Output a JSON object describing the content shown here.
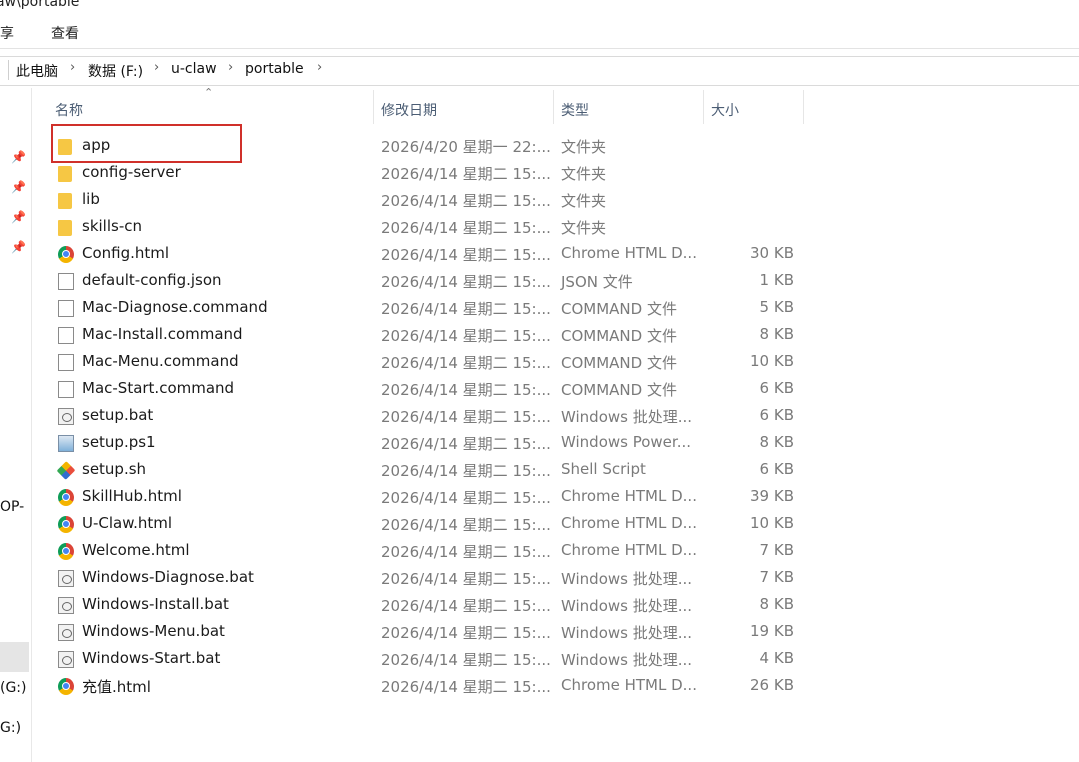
{
  "window": {
    "title_path": "aw\\portable"
  },
  "menu": {
    "share": "享",
    "view": "查看"
  },
  "breadcrumb": [
    "此电脑",
    "数据 (F:)",
    "u-claw",
    "portable"
  ],
  "sidebar": {
    "truncated_labels": [
      "OP-",
      "(G:)",
      "G:)"
    ]
  },
  "columns": {
    "name": "名称",
    "date": "修改日期",
    "type": "类型",
    "size": "大小"
  },
  "files": [
    {
      "name": "app",
      "date": "2026/4/20 星期一 22:...",
      "type": "文件夹",
      "size": "",
      "icon": "folder-icon"
    },
    {
      "name": "config-server",
      "date": "2026/4/14 星期二 15:...",
      "type": "文件夹",
      "size": "",
      "icon": "folder-icon"
    },
    {
      "name": "lib",
      "date": "2026/4/14 星期二 15:...",
      "type": "文件夹",
      "size": "",
      "icon": "folder-icon"
    },
    {
      "name": "skills-cn",
      "date": "2026/4/14 星期二 15:...",
      "type": "文件夹",
      "size": "",
      "icon": "folder-icon"
    },
    {
      "name": "Config.html",
      "date": "2026/4/14 星期二 15:...",
      "type": "Chrome HTML D...",
      "size": "30 KB",
      "icon": "chrome-html-icon"
    },
    {
      "name": "default-config.json",
      "date": "2026/4/14 星期二 15:...",
      "type": "JSON 文件",
      "size": "1 KB",
      "icon": "document-icon"
    },
    {
      "name": "Mac-Diagnose.command",
      "date": "2026/4/14 星期二 15:...",
      "type": "COMMAND 文件",
      "size": "5 KB",
      "icon": "document-icon"
    },
    {
      "name": "Mac-Install.command",
      "date": "2026/4/14 星期二 15:...",
      "type": "COMMAND 文件",
      "size": "8 KB",
      "icon": "document-icon"
    },
    {
      "name": "Mac-Menu.command",
      "date": "2026/4/14 星期二 15:...",
      "type": "COMMAND 文件",
      "size": "10 KB",
      "icon": "document-icon"
    },
    {
      "name": "Mac-Start.command",
      "date": "2026/4/14 星期二 15:...",
      "type": "COMMAND 文件",
      "size": "6 KB",
      "icon": "document-icon"
    },
    {
      "name": "setup.bat",
      "date": "2026/4/14 星期二 15:...",
      "type": "Windows 批处理...",
      "size": "6 KB",
      "icon": "batch-file-icon"
    },
    {
      "name": "setup.ps1",
      "date": "2026/4/14 星期二 15:...",
      "type": "Windows Power...",
      "size": "8 KB",
      "icon": "powershell-icon"
    },
    {
      "name": "setup.sh",
      "date": "2026/4/14 星期二 15:...",
      "type": "Shell Script",
      "size": "6 KB",
      "icon": "git-shell-icon"
    },
    {
      "name": "SkillHub.html",
      "date": "2026/4/14 星期二 15:...",
      "type": "Chrome HTML D...",
      "size": "39 KB",
      "icon": "chrome-html-icon"
    },
    {
      "name": "U-Claw.html",
      "date": "2026/4/14 星期二 15:...",
      "type": "Chrome HTML D...",
      "size": "10 KB",
      "icon": "chrome-html-icon"
    },
    {
      "name": "Welcome.html",
      "date": "2026/4/14 星期二 15:...",
      "type": "Chrome HTML D...",
      "size": "7 KB",
      "icon": "chrome-html-icon"
    },
    {
      "name": "Windows-Diagnose.bat",
      "date": "2026/4/14 星期二 15:...",
      "type": "Windows 批处理...",
      "size": "7 KB",
      "icon": "batch-file-icon"
    },
    {
      "name": "Windows-Install.bat",
      "date": "2026/4/14 星期二 15:...",
      "type": "Windows 批处理...",
      "size": "8 KB",
      "icon": "batch-file-icon"
    },
    {
      "name": "Windows-Menu.bat",
      "date": "2026/4/14 星期二 15:...",
      "type": "Windows 批处理...",
      "size": "19 KB",
      "icon": "batch-file-icon"
    },
    {
      "name": "Windows-Start.bat",
      "date": "2026/4/14 星期二 15:...",
      "type": "Windows 批处理...",
      "size": "4 KB",
      "icon": "batch-file-icon"
    },
    {
      "name": "充值.html",
      "date": "2026/4/14 星期二 15:...",
      "type": "Chrome HTML D...",
      "size": "26 KB",
      "icon": "chrome-html-icon"
    }
  ],
  "colors": {
    "highlight": "#d0302a",
    "folder": "#f6c744",
    "header_text": "#4b5d74"
  }
}
